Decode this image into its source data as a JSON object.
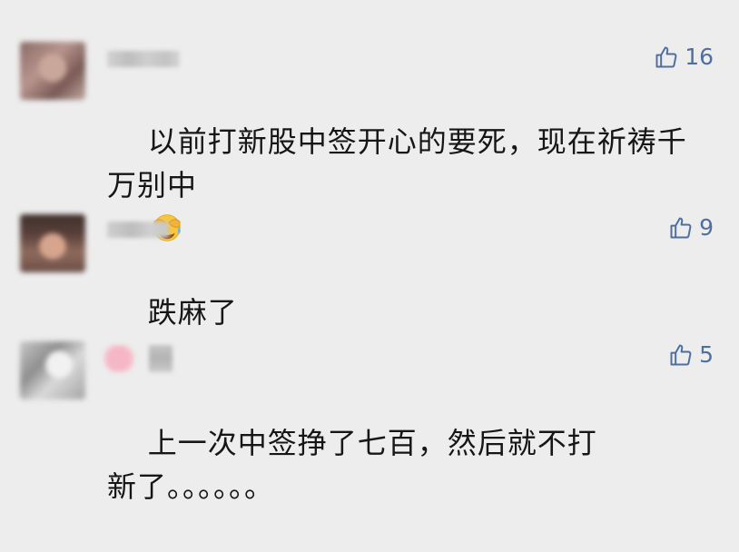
{
  "comments": [
    {
      "likes": "16",
      "text": "以前打新股中签开心的要死，现在祈祷千万别中",
      "emoji": "face-with-tears-of-joy-covered"
    },
    {
      "likes": "9",
      "text": "跌麻了"
    },
    {
      "likes": "5",
      "text": "上一次中签挣了七百，然后就不打新了。。。。。。"
    }
  ],
  "icons": {
    "like": "thumbs-up-outline-icon"
  },
  "colors": {
    "background": "#ededed",
    "like_accent": "#4f6fa0",
    "text": "#161616"
  }
}
